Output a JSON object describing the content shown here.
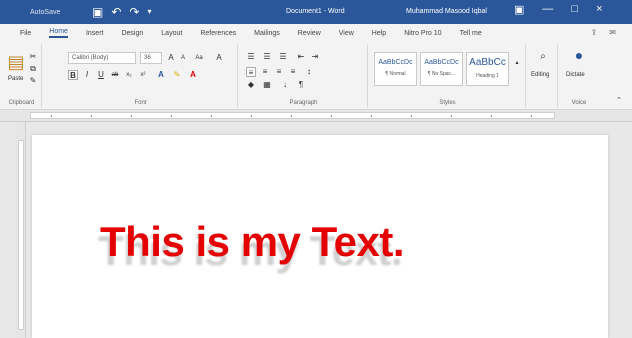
{
  "window": {
    "autosave_label": "AutoSave",
    "document_title": "Document1 - Word",
    "user_name": "Muhammad Masood Iqbal"
  },
  "tabs": [
    "File",
    "Home",
    "Insert",
    "Design",
    "Layout",
    "References",
    "Mailings",
    "Review",
    "View",
    "Help",
    "Nitro Pro 10",
    "Tell me"
  ],
  "ribbon": {
    "clipboard": {
      "paste_label": "Paste",
      "group_label": "Clipboard"
    },
    "font": {
      "font_name": "Calibri (Body)",
      "font_size": "36",
      "group_label": "Font",
      "buttons": [
        "B",
        "I",
        "U",
        "ab",
        "x₂",
        "x²",
        "A",
        "A"
      ]
    },
    "paragraph": {
      "group_label": "Paragraph"
    },
    "styles": {
      "group_label": "Styles",
      "items": [
        {
          "sample": "AaBbCcDc",
          "name": "¶ Normal"
        },
        {
          "sample": "AaBbCcDc",
          "name": "¶ No Spac..."
        },
        {
          "sample": "AaBbCc",
          "name": "Heading 1"
        }
      ]
    },
    "editing": {
      "label": "Editing"
    },
    "voice": {
      "label": "Dictate",
      "group_label": "Voice"
    }
  },
  "document": {
    "text": "This is my Text."
  },
  "colors": {
    "title_bar": "#2b579a",
    "text_color": "#e40000"
  }
}
